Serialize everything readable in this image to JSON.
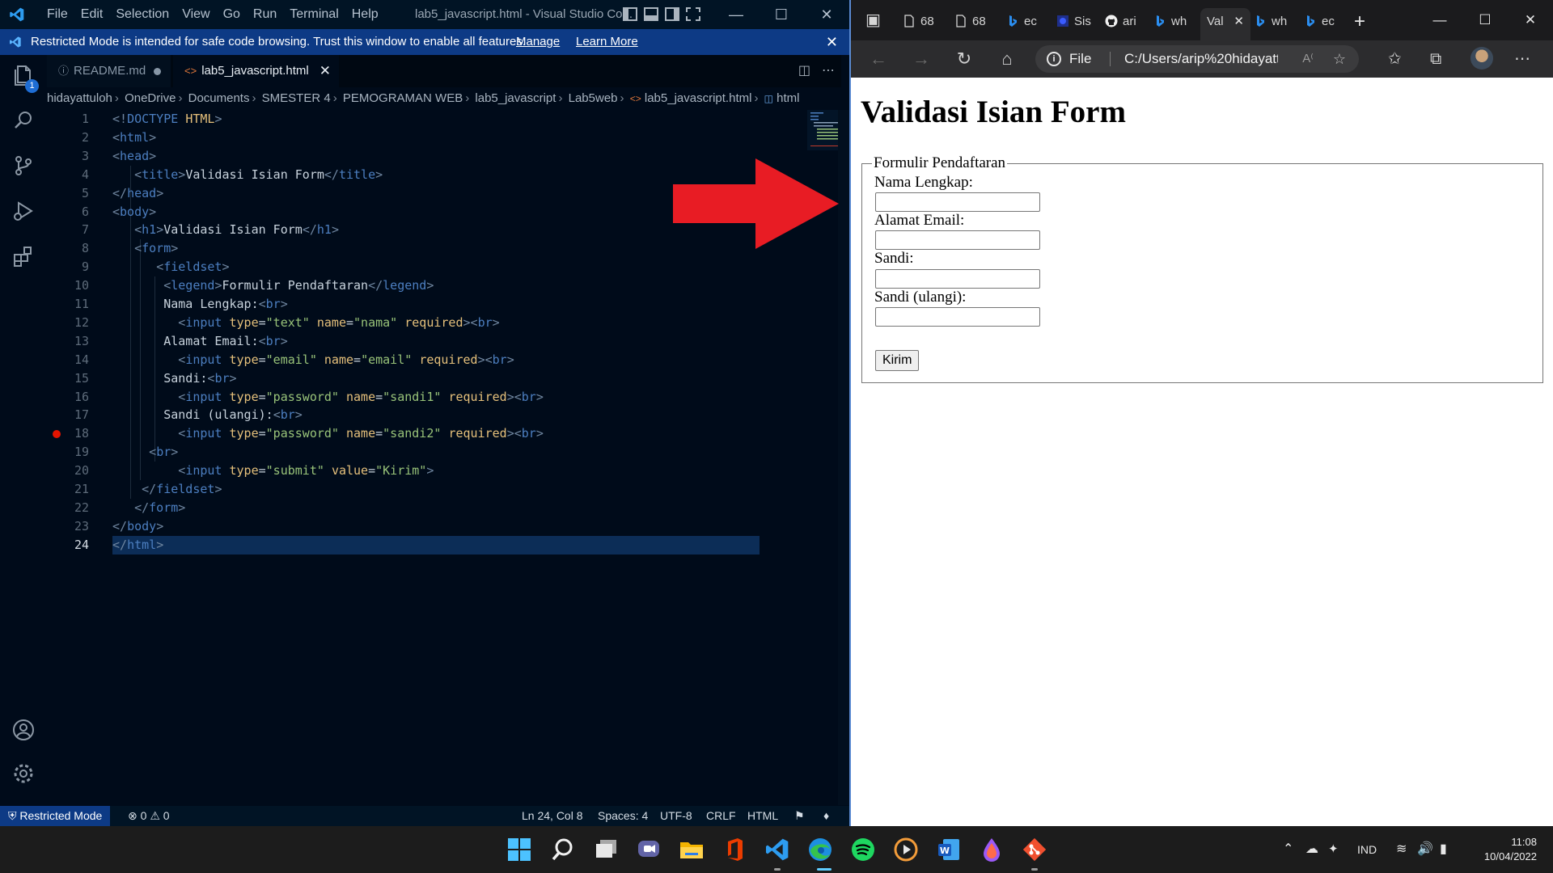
{
  "vscode": {
    "menu": [
      "File",
      "Edit",
      "Selection",
      "View",
      "Go",
      "Run",
      "Terminal",
      "Help"
    ],
    "window_title": "lab5_javascript.html - Visual Studio Co...",
    "banner": {
      "message": "Restricted Mode is intended for safe code browsing. Trust this window to enable all features.",
      "manage": "Manage",
      "learn_more": "Learn More"
    },
    "explorer_badge": "1",
    "tabs": [
      {
        "label": "README.md",
        "modified": true
      },
      {
        "label": "lab5_javascript.html",
        "active": true
      }
    ],
    "breadcrumb": [
      "hidayattuloh",
      "OneDrive",
      "Documents",
      "SMESTER 4",
      "PEMOGRAMAN WEB",
      "lab5_javascript",
      "Lab5web",
      "lab5_javascript.html",
      "html"
    ],
    "breakpoint_line": 18,
    "active_line": 24,
    "code_lines": [
      [
        [
          "tg",
          "<!"
        ],
        [
          "tn",
          "DOCTYPE"
        ],
        [
          "tx",
          " "
        ],
        [
          "dt",
          "HTML"
        ],
        [
          "tg",
          ">"
        ]
      ],
      [
        [
          "tg",
          "<"
        ],
        [
          "tn",
          "html"
        ],
        [
          "tg",
          ">"
        ]
      ],
      [
        [
          "tg",
          "<"
        ],
        [
          "tn",
          "head"
        ],
        [
          "tg",
          ">"
        ]
      ],
      [
        [
          "tx",
          "   "
        ],
        [
          "tg",
          "<"
        ],
        [
          "tn",
          "title"
        ],
        [
          "tg",
          ">"
        ],
        [
          "tx",
          "Validasi Isian Form"
        ],
        [
          "tg",
          "</"
        ],
        [
          "tn",
          "title"
        ],
        [
          "tg",
          ">"
        ]
      ],
      [
        [
          "tg",
          "</"
        ],
        [
          "tn",
          "head"
        ],
        [
          "tg",
          ">"
        ]
      ],
      [
        [
          "tg",
          "<"
        ],
        [
          "tn",
          "body"
        ],
        [
          "tg",
          ">"
        ]
      ],
      [
        [
          "tx",
          "   "
        ],
        [
          "tg",
          "<"
        ],
        [
          "tn",
          "h1"
        ],
        [
          "tg",
          ">"
        ],
        [
          "tx",
          "Validasi Isian Form"
        ],
        [
          "tg",
          "</"
        ],
        [
          "tn",
          "h1"
        ],
        [
          "tg",
          ">"
        ]
      ],
      [
        [
          "tx",
          "   "
        ],
        [
          "tg",
          "<"
        ],
        [
          "tn",
          "form"
        ],
        [
          "tg",
          ">"
        ]
      ],
      [
        [
          "tx",
          "      "
        ],
        [
          "tg",
          "<"
        ],
        [
          "tn",
          "fieldset"
        ],
        [
          "tg",
          ">"
        ]
      ],
      [
        [
          "tx",
          "       "
        ],
        [
          "tg",
          "<"
        ],
        [
          "tn",
          "legend"
        ],
        [
          "tg",
          ">"
        ],
        [
          "tx",
          "Formulir Pendaftaran"
        ],
        [
          "tg",
          "</"
        ],
        [
          "tn",
          "legend"
        ],
        [
          "tg",
          ">"
        ]
      ],
      [
        [
          "tx",
          "       Nama Lengkap:"
        ],
        [
          "tg",
          "<"
        ],
        [
          "tn",
          "br"
        ],
        [
          "tg",
          ">"
        ]
      ],
      [
        [
          "tx",
          "         "
        ],
        [
          "tg",
          "<"
        ],
        [
          "tn",
          "input"
        ],
        [
          "tx",
          " "
        ],
        [
          "at",
          "type"
        ],
        [
          "tx",
          "="
        ],
        [
          "st",
          "\"text\""
        ],
        [
          "tx",
          " "
        ],
        [
          "at",
          "name"
        ],
        [
          "tx",
          "="
        ],
        [
          "st",
          "\"nama\""
        ],
        [
          "tx",
          " "
        ],
        [
          "at",
          "required"
        ],
        [
          "tg",
          "><"
        ],
        [
          "tn",
          "br"
        ],
        [
          "tg",
          ">"
        ]
      ],
      [
        [
          "tx",
          "       Alamat Email:"
        ],
        [
          "tg",
          "<"
        ],
        [
          "tn",
          "br"
        ],
        [
          "tg",
          ">"
        ]
      ],
      [
        [
          "tx",
          "         "
        ],
        [
          "tg",
          "<"
        ],
        [
          "tn",
          "input"
        ],
        [
          "tx",
          " "
        ],
        [
          "at",
          "type"
        ],
        [
          "tx",
          "="
        ],
        [
          "st",
          "\"email\""
        ],
        [
          "tx",
          " "
        ],
        [
          "at",
          "name"
        ],
        [
          "tx",
          "="
        ],
        [
          "st",
          "\"email\""
        ],
        [
          "tx",
          " "
        ],
        [
          "at",
          "required"
        ],
        [
          "tg",
          "><"
        ],
        [
          "tn",
          "br"
        ],
        [
          "tg",
          ">"
        ]
      ],
      [
        [
          "tx",
          "       Sandi:"
        ],
        [
          "tg",
          "<"
        ],
        [
          "tn",
          "br"
        ],
        [
          "tg",
          ">"
        ]
      ],
      [
        [
          "tx",
          "         "
        ],
        [
          "tg",
          "<"
        ],
        [
          "tn",
          "input"
        ],
        [
          "tx",
          " "
        ],
        [
          "at",
          "type"
        ],
        [
          "tx",
          "="
        ],
        [
          "st",
          "\"password\""
        ],
        [
          "tx",
          " "
        ],
        [
          "at",
          "name"
        ],
        [
          "tx",
          "="
        ],
        [
          "st",
          "\"sandi1\""
        ],
        [
          "tx",
          " "
        ],
        [
          "at",
          "required"
        ],
        [
          "tg",
          "><"
        ],
        [
          "tn",
          "br"
        ],
        [
          "tg",
          ">"
        ]
      ],
      [
        [
          "tx",
          "       Sandi (ulangi):"
        ],
        [
          "tg",
          "<"
        ],
        [
          "tn",
          "br"
        ],
        [
          "tg",
          ">"
        ]
      ],
      [
        [
          "tx",
          "         "
        ],
        [
          "tg",
          "<"
        ],
        [
          "tn",
          "input"
        ],
        [
          "tx",
          " "
        ],
        [
          "at",
          "type"
        ],
        [
          "tx",
          "="
        ],
        [
          "st",
          "\"password\""
        ],
        [
          "tx",
          " "
        ],
        [
          "at",
          "name"
        ],
        [
          "tx",
          "="
        ],
        [
          "st",
          "\"sandi2\""
        ],
        [
          "tx",
          " "
        ],
        [
          "at",
          "required"
        ],
        [
          "tg",
          "><"
        ],
        [
          "tn",
          "br"
        ],
        [
          "tg",
          ">"
        ]
      ],
      [
        [
          "tx",
          "     "
        ],
        [
          "tg",
          "<"
        ],
        [
          "tn",
          "br"
        ],
        [
          "tg",
          ">"
        ]
      ],
      [
        [
          "tx",
          "         "
        ],
        [
          "tg",
          "<"
        ],
        [
          "tn",
          "input"
        ],
        [
          "tx",
          " "
        ],
        [
          "at",
          "type"
        ],
        [
          "tx",
          "="
        ],
        [
          "st",
          "\"submit\""
        ],
        [
          "tx",
          " "
        ],
        [
          "at",
          "value"
        ],
        [
          "tx",
          "="
        ],
        [
          "st",
          "\"Kirim\""
        ],
        [
          "tg",
          ">"
        ]
      ],
      [
        [
          "tx",
          "    "
        ],
        [
          "tg",
          "</"
        ],
        [
          "tn",
          "fieldset"
        ],
        [
          "tg",
          ">"
        ]
      ],
      [
        [
          "tx",
          "   "
        ],
        [
          "tg",
          "</"
        ],
        [
          "tn",
          "form"
        ],
        [
          "tg",
          ">"
        ]
      ],
      [
        [
          "tg",
          "</"
        ],
        [
          "tn",
          "body"
        ],
        [
          "tg",
          ">"
        ]
      ],
      [
        [
          "tg",
          "</"
        ],
        [
          "tn",
          "html"
        ],
        [
          "tg",
          ">"
        ]
      ]
    ],
    "status": {
      "restricted": "Restricted Mode",
      "errors": "0",
      "warnings": "0",
      "position": "Ln 24, Col 8",
      "spaces": "Spaces: 4",
      "encoding": "UTF-8",
      "eol": "CRLF",
      "language": "HTML"
    }
  },
  "edge": {
    "tabs": [
      {
        "label": "68",
        "icon": "page-icon"
      },
      {
        "label": "68",
        "icon": "page-icon"
      },
      {
        "label": "ec",
        "icon": "bing-icon"
      },
      {
        "label": "Sis",
        "icon": "site-icon"
      },
      {
        "label": "ari",
        "icon": "github-icon"
      },
      {
        "label": "wh",
        "icon": "bing-icon"
      },
      {
        "label": "Val",
        "icon": "none",
        "active": true
      },
      {
        "label": "wh",
        "icon": "bing-icon"
      },
      {
        "label": "ec",
        "icon": "bing-icon"
      }
    ],
    "address": {
      "scheme": "File",
      "url": "C:/Users/arip%20hidayattul..."
    },
    "page": {
      "h1": "Validasi Isian Form",
      "legend": "Formulir Pendaftaran",
      "labels": [
        "Nama Lengkap:",
        "Alamat Email:",
        "Sandi:",
        "Sandi (ulangi):"
      ],
      "submit": "Kirim"
    }
  },
  "taskbar": {
    "apps": [
      "start-icon",
      "search-icon",
      "task-view-icon",
      "teams-chat-icon",
      "file-explorer-icon",
      "office-icon",
      "vscode-icon",
      "edge-icon",
      "spotify-icon",
      "media-player-icon",
      "word-icon",
      "paint-3d-icon",
      "git-icon"
    ],
    "tray_lang": "IND",
    "time": "11:08",
    "date": "10/04/2022"
  },
  "colors": {
    "vs_bg": "#000b1a",
    "banner": "#0d3a85",
    "arrow": "#e81c24",
    "tag_name": "#4c7fc1",
    "attribute": "#e5c07b",
    "string": "#98c379"
  }
}
